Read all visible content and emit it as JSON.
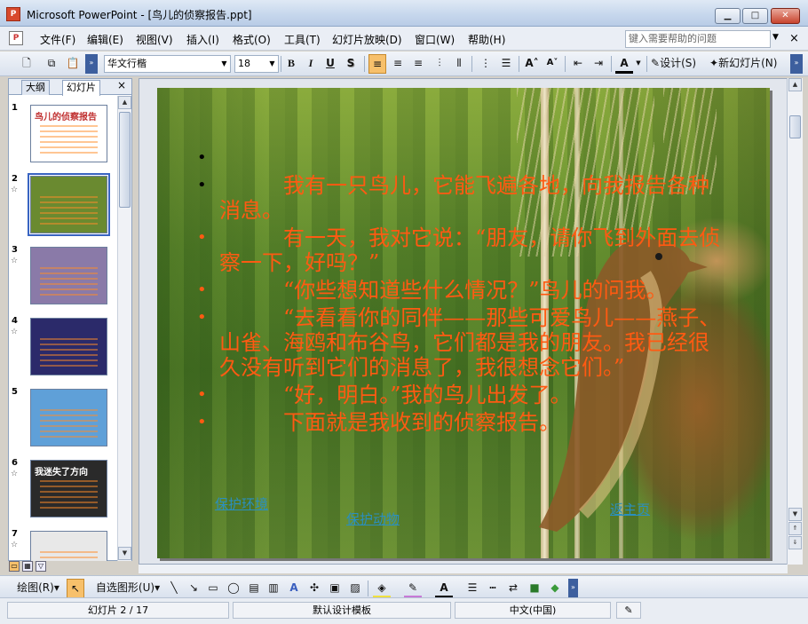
{
  "window": {
    "title": "Microsoft PowerPoint - [鸟儿的侦察报告.ppt]",
    "app_icon": "powerpoint-icon",
    "minimize": "minimize-icon",
    "maximize": "maximize-icon",
    "close": "close-icon"
  },
  "menu": {
    "items": [
      "文件(F)",
      "编辑(E)",
      "视图(V)",
      "插入(I)",
      "格式(O)",
      "工具(T)",
      "幻灯片放映(D)",
      "窗口(W)",
      "帮助(H)"
    ],
    "help_placeholder": "键入需要帮助的问题",
    "close_glyph": "×"
  },
  "toolbar": {
    "font": "华文行楷",
    "size": "18",
    "bold": "B",
    "italic": "I",
    "underline": "U",
    "shadow": "S",
    "font_color": "A",
    "design": "设计(S)",
    "new_slide": "新幻灯片(N)"
  },
  "panel": {
    "tab_outline": "大纲",
    "tab_slides": "幻灯片",
    "close_glyph": "×",
    "thumbnails": [
      {
        "number": "1",
        "star": false,
        "title": "鸟儿的侦察报告",
        "selected": false,
        "bg": "#ffffff"
      },
      {
        "number": "2",
        "star": true,
        "title": "",
        "selected": true,
        "bg": "#6a8a30"
      },
      {
        "number": "3",
        "star": true,
        "title": "",
        "selected": false,
        "bg": "#8a7aa8"
      },
      {
        "number": "4",
        "star": true,
        "title": "",
        "selected": false,
        "bg": "#2b2a6a"
      },
      {
        "number": "5",
        "star": false,
        "title": "",
        "selected": false,
        "bg": "#5fa0d8"
      },
      {
        "number": "6",
        "star": true,
        "title": "我迷失了方向",
        "selected": false,
        "bg": "#2a2a2a"
      },
      {
        "number": "7",
        "star": true,
        "title": "",
        "selected": false,
        "bg": "#e8e8e8"
      }
    ]
  },
  "slide": {
    "bullets": [
      {
        "text": "",
        "bullet_color": "#000000"
      },
      {
        "text": "　　　我有一只鸟儿，它能飞遍各地，向我报告各种消息。",
        "bullet_color": "#000000"
      },
      {
        "text": "　　　有一天，我对它说：“朋友，请你飞到外面去侦察一下，好吗？”",
        "bullet_color": "#ff5a12"
      },
      {
        "text": "　　　“你些想知道些什么情况？”鸟儿的问我。",
        "bullet_color": "#ff5a12"
      },
      {
        "text": "　　　“去看看你的同伴——那些可爱鸟儿——燕子、山雀、海鸥和布谷鸟，它们都是我的朋友。我已经很久没有听到它们的消息了，我很想念它们。”",
        "bullet_color": "#ff5a12"
      },
      {
        "text": "　　　“好，明白。”我的鸟儿出发了。",
        "bullet_color": "#ff5a12"
      },
      {
        "text": "　　　下面就是我收到的侦察报告。",
        "bullet_color": "#ff5a12"
      }
    ],
    "links": [
      "保护环境",
      "保护动物",
      "返主页"
    ],
    "text_color": "#ff5a12",
    "link_color": "#2a8fbf"
  },
  "drawbar": {
    "draw": "绘图(R)",
    "autoshapes": "自选图形(U)"
  },
  "status": {
    "slide_counter": "幻灯片 2 / 17",
    "template": "默认设计模板",
    "language": "中文(中国)"
  }
}
